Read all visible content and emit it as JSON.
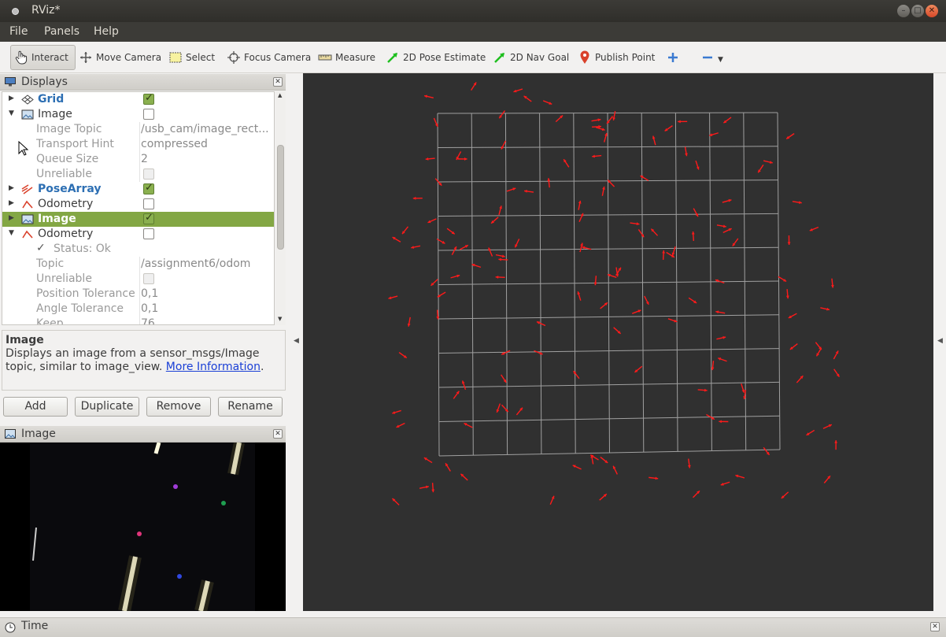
{
  "window": {
    "title": "RViz*"
  },
  "menu": {
    "file": "File",
    "panels": "Panels",
    "help": "Help"
  },
  "toolbar": {
    "interact": "Interact",
    "move_camera": "Move Camera",
    "select": "Select",
    "focus_camera": "Focus Camera",
    "measure": "Measure",
    "pose_estimate": "2D Pose Estimate",
    "nav_goal": "2D Nav Goal",
    "publish_point": "Publish Point"
  },
  "displays": {
    "title": "Displays",
    "rows": [
      {
        "name": "Grid"
      },
      {
        "name": "Image"
      },
      {
        "name": "Image Topic",
        "value": "/usb_cam/image_rect..."
      },
      {
        "name": "Transport Hint",
        "value": "compressed"
      },
      {
        "name": "Queue Size",
        "value": "2"
      },
      {
        "name": "Unreliable"
      },
      {
        "name": "PoseArray"
      },
      {
        "name": "Odometry"
      },
      {
        "name": "Image"
      },
      {
        "name": "Odometry"
      },
      {
        "name": "Status: Ok"
      },
      {
        "name": "Topic",
        "value": "/assignment6/odom"
      },
      {
        "name": "Unreliable"
      },
      {
        "name": "Position Tolerance",
        "value": "0,1"
      },
      {
        "name": "Angle Tolerance",
        "value": "0,1"
      },
      {
        "name": "Keep",
        "value": "76"
      }
    ]
  },
  "description": {
    "title": "Image",
    "text": "Displays an image from a sensor_msgs/Image topic, similar to image_view.",
    "link": "More Information",
    "suffix": "."
  },
  "buttons": {
    "add": "Add",
    "duplicate": "Duplicate",
    "remove": "Remove",
    "rename": "Rename"
  },
  "image_panel": {
    "title": "Image"
  },
  "time_panel": {
    "title": "Time"
  }
}
